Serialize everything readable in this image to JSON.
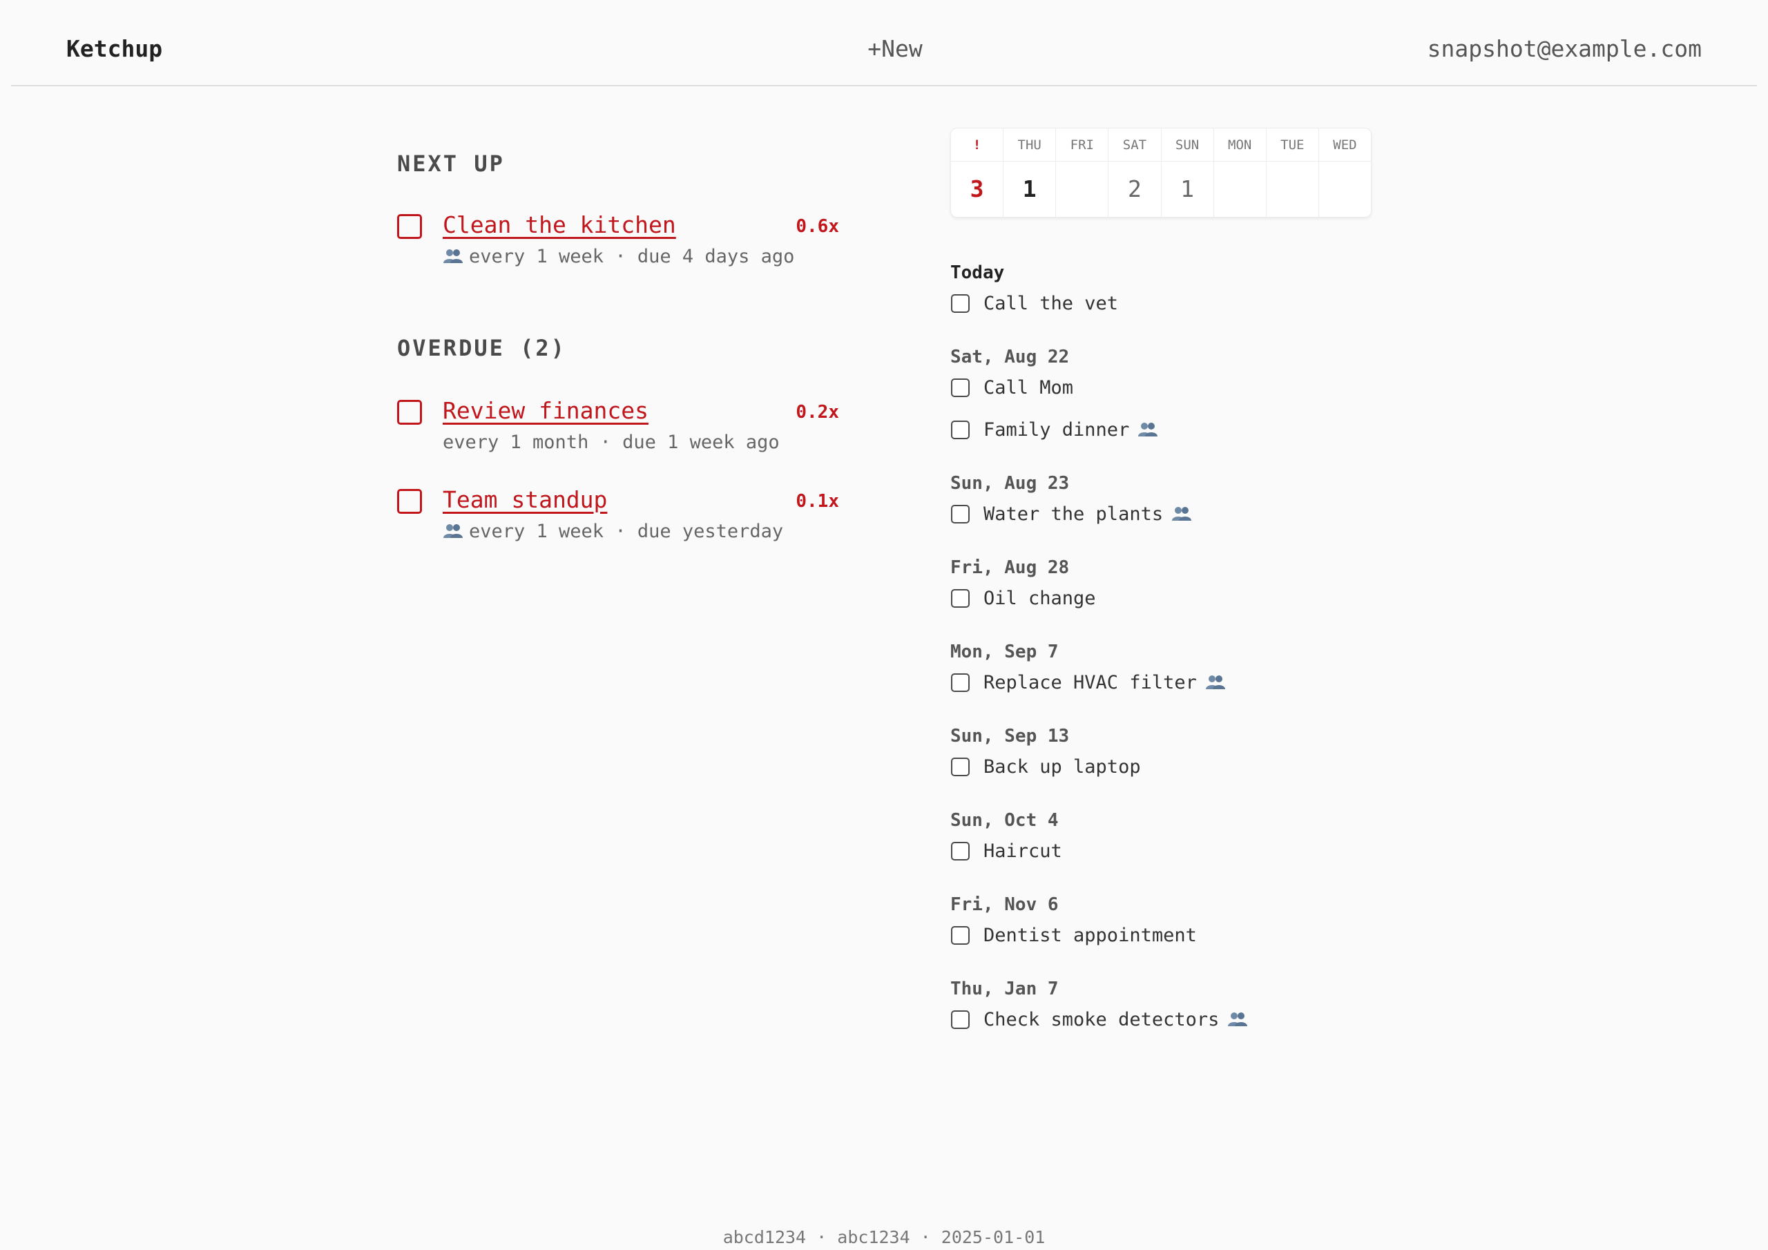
{
  "header": {
    "brand": "Ketchup",
    "new_label": "+New",
    "user_email": "snapshot@example.com"
  },
  "next_up": {
    "title": "NEXT UP",
    "tasks": [
      {
        "name": "Clean the kitchen",
        "ratio": "0.6x",
        "meta": "every 1 week · due 4 days ago",
        "shared": true
      }
    ]
  },
  "overdue": {
    "title": "OVERDUE (2)",
    "tasks": [
      {
        "name": "Review finances",
        "ratio": "0.2x",
        "meta": "every 1 month · due 1 week ago",
        "shared": false
      },
      {
        "name": "Team standup",
        "ratio": "0.1x",
        "meta": "every 1 week · due yesterday",
        "shared": true
      }
    ]
  },
  "calendar": {
    "days": [
      {
        "label": "!",
        "count": "3"
      },
      {
        "label": "THU",
        "count": "1"
      },
      {
        "label": "FRI",
        "count": ""
      },
      {
        "label": "SAT",
        "count": "2"
      },
      {
        "label": "SUN",
        "count": "1"
      },
      {
        "label": "MON",
        "count": ""
      },
      {
        "label": "TUE",
        "count": ""
      },
      {
        "label": "WED",
        "count": ""
      }
    ]
  },
  "agenda": {
    "groups": [
      {
        "day": "Today",
        "items": [
          {
            "title": "Call the vet",
            "shared": false
          }
        ]
      },
      {
        "day": "Sat, Aug 22",
        "items": [
          {
            "title": "Call Mom",
            "shared": false
          },
          {
            "title": "Family dinner",
            "shared": true
          }
        ]
      },
      {
        "day": "Sun, Aug 23",
        "items": [
          {
            "title": "Water the plants",
            "shared": true
          }
        ]
      },
      {
        "day": "Fri, Aug 28",
        "items": [
          {
            "title": "Oil change",
            "shared": false
          }
        ]
      },
      {
        "day": "Mon, Sep 7",
        "items": [
          {
            "title": "Replace HVAC filter",
            "shared": true
          }
        ]
      },
      {
        "day": "Sun, Sep 13",
        "items": [
          {
            "title": "Back up laptop",
            "shared": false
          }
        ]
      },
      {
        "day": "Sun, Oct 4",
        "items": [
          {
            "title": "Haircut",
            "shared": false
          }
        ]
      },
      {
        "day": "Fri, Nov 6",
        "items": [
          {
            "title": "Dentist appointment",
            "shared": false
          }
        ]
      },
      {
        "day": "Thu, Jan 7",
        "items": [
          {
            "title": "Check smoke detectors",
            "shared": true
          }
        ]
      }
    ]
  },
  "footer": {
    "text": "abcd1234 · abc1234 · 2025-01-01"
  },
  "colors": {
    "accent": "#c0161c",
    "background": "#fafafa",
    "text": "#333333",
    "muted": "#666666"
  },
  "icons": {
    "shared": "people-icon"
  }
}
